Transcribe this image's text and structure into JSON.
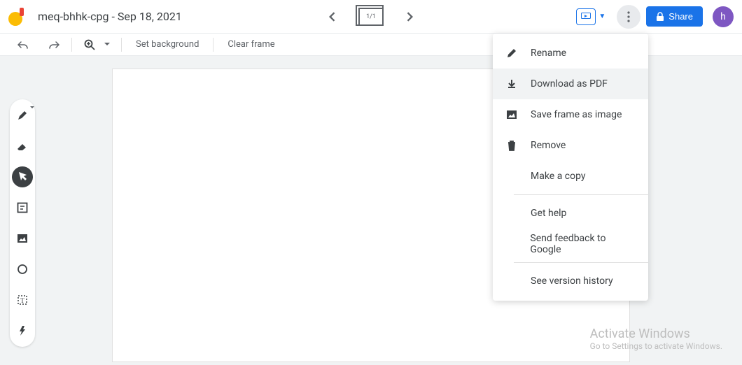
{
  "header": {
    "title": "meq-bhhk-cpg - Sep 18, 2021",
    "frame_indicator": "1/1",
    "share_label": "Share",
    "avatar_letter": "h"
  },
  "toolbar": {
    "set_background": "Set background",
    "clear_frame": "Clear frame"
  },
  "menu": {
    "rename": "Rename",
    "download_pdf": "Download as PDF",
    "save_image": "Save frame as image",
    "remove": "Remove",
    "make_copy": "Make a copy",
    "get_help": "Get help",
    "feedback": "Send feedback to Google",
    "version_history": "See version history"
  },
  "watermark": {
    "line1": "Activate Windows",
    "line2": "Go to Settings to activate Windows."
  }
}
